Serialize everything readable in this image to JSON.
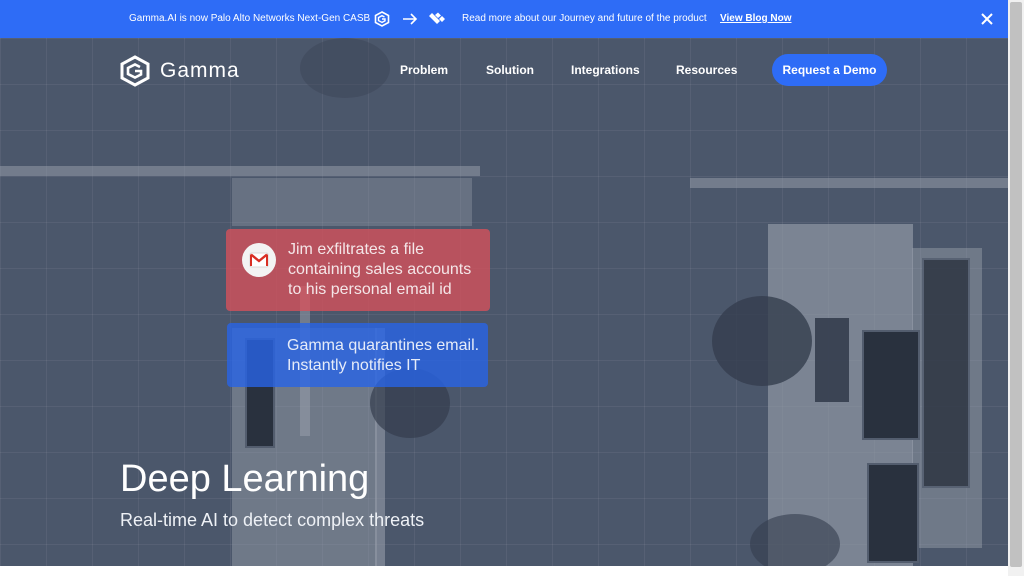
{
  "announcement": {
    "text": "Gamma.AI is now Palo Alto Networks Next-Gen CASB",
    "more_text": "Read more about our Journey and future of the product",
    "link_label": "View Blog Now",
    "icons": [
      "gamma-logo-icon",
      "arrow-right-icon",
      "palo-alto-logo-icon",
      "close-icon"
    ]
  },
  "brand": {
    "name": "Gamma"
  },
  "nav": {
    "items": [
      {
        "label": "Problem"
      },
      {
        "label": "Solution"
      },
      {
        "label": "Integrations"
      },
      {
        "label": "Resources"
      }
    ],
    "cta_label": "Request a Demo"
  },
  "hero": {
    "alert_card": {
      "icon": "gmail-icon",
      "text": "Jim exfiltrates a file containing sales accounts to his personal email id"
    },
    "response_card": {
      "text": "Gamma quarantines email. Instantly notifies IT"
    },
    "title": "Deep Learning",
    "subtitle": "Real-time AI to detect complex threats"
  },
  "colors": {
    "accent": "#2e6cf6",
    "alert": "#dc505a",
    "hero_overlay": "#28344b"
  }
}
